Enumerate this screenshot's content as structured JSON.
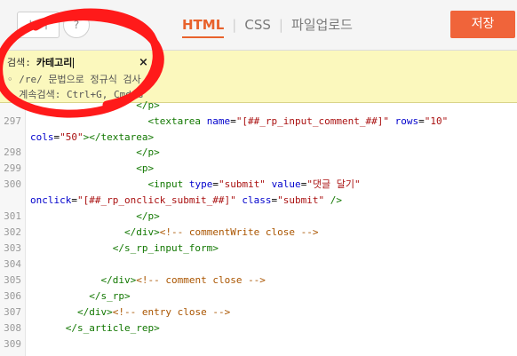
{
  "toolbar": {
    "view_button": "보기",
    "help_button": "?",
    "tabs": [
      {
        "label": "HTML",
        "active": true
      },
      {
        "label": "CSS",
        "active": false
      },
      {
        "label": "파일업로드",
        "active": false
      }
    ],
    "save_label": "저장"
  },
  "search": {
    "label": "검색:",
    "value": "카테고리",
    "close": "×",
    "hint1": "◦ /re/ 문법으로 정규식 검사",
    "hint2": "◦ 계속검색: Ctrl+G, Cmd+G"
  },
  "editor": {
    "lines": [
      {
        "num": "",
        "text": "                  </p>"
      },
      {
        "num": "297",
        "text": "                    <textarea name=\"[##_rp_input_comment_##]\" rows=\"10\""
      },
      {
        "num": "",
        "text": "cols=\"50\"></textarea>"
      },
      {
        "num": "298",
        "text": "                  </p>"
      },
      {
        "num": "299",
        "text": "                  <p>"
      },
      {
        "num": "300",
        "text": "                    <input type=\"submit\" value=\"댓글 달기\""
      },
      {
        "num": "",
        "text": "onclick=\"[##_rp_onclick_submit_##]\" class=\"submit\" />"
      },
      {
        "num": "301",
        "text": "                  </p>"
      },
      {
        "num": "302",
        "text": "                </div><!-- commentWrite close -->"
      },
      {
        "num": "303",
        "text": "              </s_rp_input_form>"
      },
      {
        "num": "304",
        "text": ""
      },
      {
        "num": "305",
        "text": "            </div><!-- comment close -->"
      },
      {
        "num": "306",
        "text": "          </s_rp>"
      },
      {
        "num": "307",
        "text": "        </div><!-- entry close -->"
      },
      {
        "num": "308",
        "text": "      </s_article_rep>"
      },
      {
        "num": "309",
        "text": ""
      }
    ]
  },
  "colors": {
    "accent": "#e8622c",
    "save_button": "#f0643a",
    "search_panel_bg": "#fbf8bd",
    "annotation": "#ff0000"
  }
}
